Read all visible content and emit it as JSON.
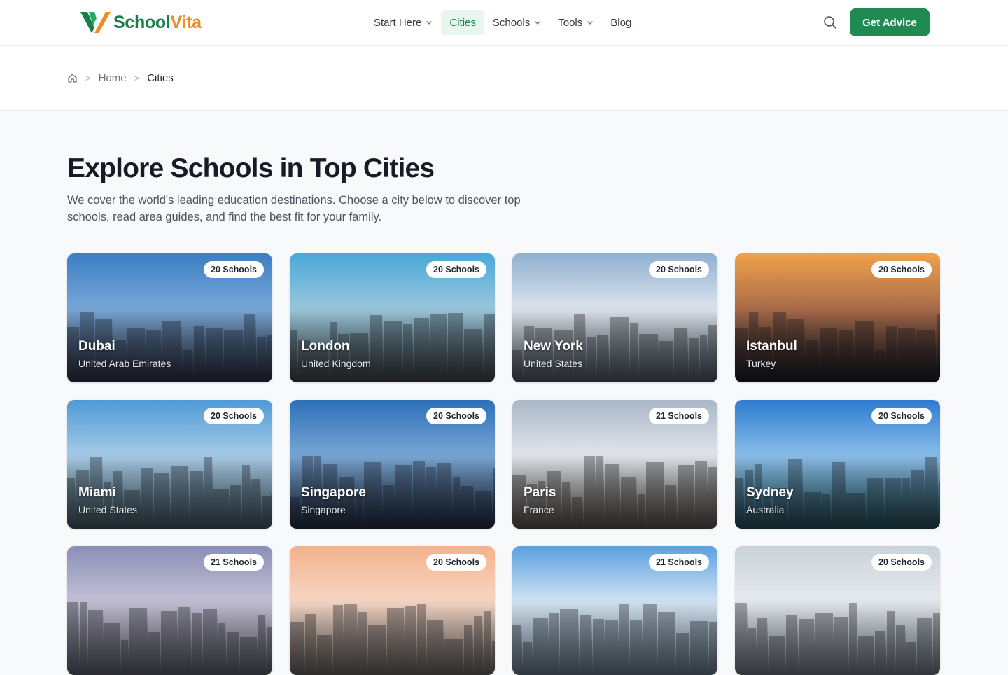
{
  "brand": {
    "part1": "School",
    "part2": "Vita"
  },
  "nav": {
    "items": [
      {
        "label": "Start Here",
        "dropdown": true,
        "active": false
      },
      {
        "label": "Cities",
        "dropdown": false,
        "active": true
      },
      {
        "label": "Schools",
        "dropdown": true,
        "active": false
      },
      {
        "label": "Tools",
        "dropdown": true,
        "active": false
      },
      {
        "label": "Blog",
        "dropdown": false,
        "active": false
      }
    ],
    "cta_label": "Get Advice"
  },
  "breadcrumb": {
    "home": "Home",
    "current": "Cities"
  },
  "hero": {
    "title": "Explore Schools in Top Cities",
    "subtitle": "We cover the world's leading education destinations. Choose a city below to discover top schools, read area guides, and find the best fit for your family."
  },
  "cities": [
    {
      "name": "Dubai",
      "country": "United Arab Emirates",
      "schools": "20 Schools",
      "sky": [
        "#3a7fc4",
        "#7aa9d8",
        "#3a3e56"
      ]
    },
    {
      "name": "London",
      "country": "United Kingdom",
      "schools": "20 Schools",
      "sky": [
        "#4aa8d8",
        "#9cc8dc",
        "#4f5a5e"
      ]
    },
    {
      "name": "New York",
      "country": "United States",
      "schools": "20 Schools",
      "sky": [
        "#8fb0d0",
        "#dfe6ee",
        "#6d7a86"
      ]
    },
    {
      "name": "Istanbul",
      "country": "Turkey",
      "schools": "20 Schools",
      "sky": [
        "#f0a14a",
        "#a66a4a",
        "#1b1d26"
      ]
    },
    {
      "name": "Miami",
      "country": "United States",
      "schools": "20 Schools",
      "sky": [
        "#4f9ad6",
        "#a9cde8",
        "#5c7d8a"
      ]
    },
    {
      "name": "Singapore",
      "country": "Singapore",
      "schools": "20 Schools",
      "sky": [
        "#2b6fb8",
        "#7aa8d6",
        "#2a3a55"
      ]
    },
    {
      "name": "Paris",
      "country": "France",
      "schools": "21 Schools",
      "sky": [
        "#a9b6c6",
        "#e3e7ec",
        "#7c7466"
      ]
    },
    {
      "name": "Sydney",
      "country": "Australia",
      "schools": "20 Schools",
      "sky": [
        "#2d7bd0",
        "#8cc0ea",
        "#2d6b76"
      ]
    },
    {
      "name": "",
      "country": "",
      "schools": "21 Schools",
      "sky": [
        "#8a8fb8",
        "#c6c2d6",
        "#8a8a9a"
      ]
    },
    {
      "name": "",
      "country": "",
      "schools": "20 Schools",
      "sky": [
        "#f3b28a",
        "#f7d8c6",
        "#9a8f8a"
      ]
    },
    {
      "name": "",
      "country": "",
      "schools": "21 Schools",
      "sky": [
        "#5aa0e0",
        "#d6e6f4",
        "#9ab2c6"
      ]
    },
    {
      "name": "",
      "country": "",
      "schools": "20 Schools",
      "sky": [
        "#c9d2da",
        "#e7ebef",
        "#a2acb6"
      ]
    }
  ],
  "colors": {
    "brand_green": "#1f8a51",
    "brand_orange": "#f08a24",
    "active_nav_bg": "#e8f6ee"
  },
  "icons": {
    "search": "search-icon",
    "home": "home-icon",
    "chevron": "chevron-down-icon"
  }
}
